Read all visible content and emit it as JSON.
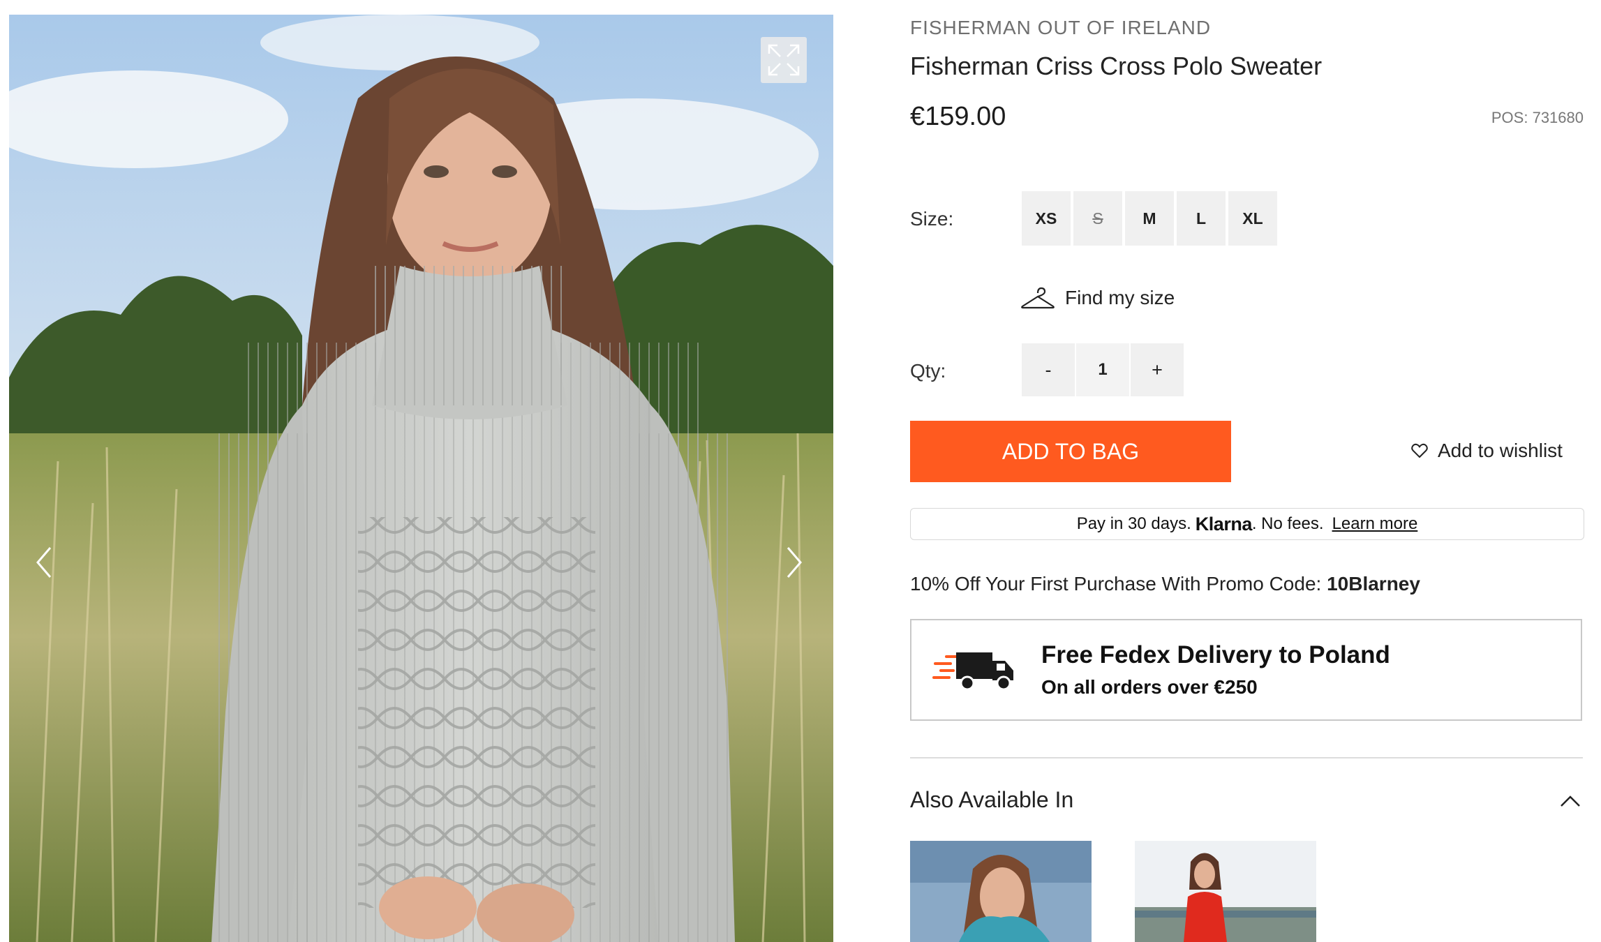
{
  "product": {
    "brand": "FISHERMAN OUT OF IRELAND",
    "title": "Fisherman Criss Cross Polo Sweater",
    "price": "€159.00",
    "pos_label": "POS:",
    "pos_value": "731680"
  },
  "gallery": {
    "icons": [
      "expand-icon",
      "chevron-left-icon",
      "chevron-right-icon"
    ]
  },
  "size": {
    "label": "Size:",
    "options": [
      {
        "label": "XS",
        "available": true
      },
      {
        "label": "S",
        "available": false
      },
      {
        "label": "M",
        "available": true
      },
      {
        "label": "L",
        "available": true
      },
      {
        "label": "XL",
        "available": true
      }
    ],
    "find_my_size": "Find my size"
  },
  "qty": {
    "label": "Qty:",
    "minus": "-",
    "value": "1",
    "plus": "+"
  },
  "actions": {
    "add_to_bag": "ADD TO BAG",
    "wishlist": "Add to wishlist"
  },
  "klarna": {
    "before": "Pay in 30 days.",
    "brand": "Klarna",
    "after": ". No fees.",
    "link": "Learn more"
  },
  "promo": {
    "text": "10% Off Your First Purchase With Promo Code:",
    "code": "10Blarney"
  },
  "delivery": {
    "title": "Free Fedex Delivery to Poland",
    "subtitle": "On all orders over €250"
  },
  "also_available": {
    "title": "Also Available In"
  },
  "colors": {
    "accent": "#ff5a1f",
    "button_bg": "#f0f0f0",
    "thumb1_sweater": "#3aa0b4",
    "thumb2_sweater": "#e02a1e"
  }
}
